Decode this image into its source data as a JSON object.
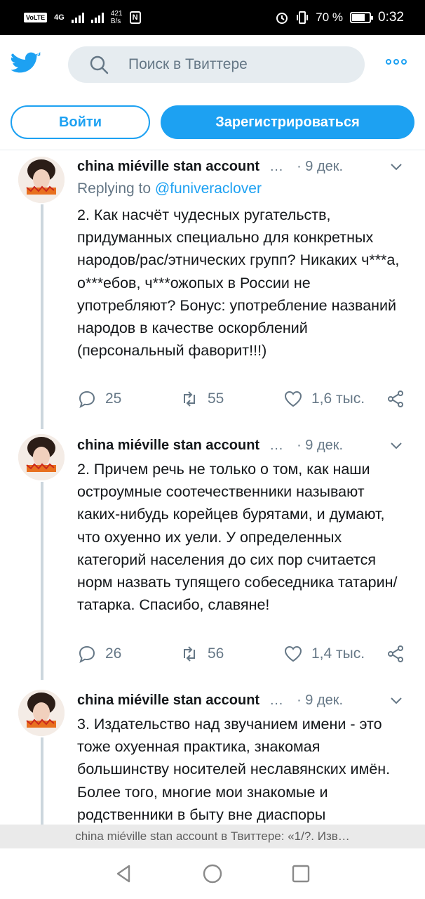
{
  "status_bar": {
    "volte": "VoLTE",
    "network": "4G",
    "speed": "421\nB/s",
    "nfc": "N",
    "battery": "70 %",
    "time": "0:32"
  },
  "header": {
    "logo_icon": "twitter-bird-icon",
    "search_placeholder": "Поиск в Твиттере",
    "more_icon": "more-dots-icon",
    "login_label": "Войти",
    "signup_label": "Зарегистрироваться",
    "accent_color": "#1da1f2"
  },
  "tweets": [
    {
      "name": "china miéville stan account",
      "dots": "…",
      "time": "· 9 дек.",
      "replying_prefix": "Replying to",
      "replying_handle": "@funiveraclover",
      "text": "2. Как насчёт чудесных ругательств, придуманных специально для конкретных народов/рас/этнических групп? Никаких ч***а, о***ебов, ч***ожопых в России не употребляют? Бонус: употребление названий народов в качестве оскорблений (персональный фаворит!!!)",
      "replies": "25",
      "retweets": "55",
      "likes": "1,6 тыс."
    },
    {
      "name": "china miéville stan account",
      "dots": "…",
      "time": "· 9 дек.",
      "text": "2. Причем речь не только о том, как наши остроумные соотечественники называют каких-нибудь корейцев бурятами, и думают, что охуенно их уели. У определенных категорий населения до сих пор считается норм назвать тупящего собеседника татарин/татарка. Спасибо, славяне!",
      "replies": "26",
      "retweets": "56",
      "likes": "1,4 тыс."
    },
    {
      "name": "china miéville stan account",
      "dots": "…",
      "time": "· 9 дек.",
      "text": "3. Издательство над звучанием имени - это тоже охуенная практика, знакомая большинству носителей неславянских имён. Более того, многие мои знакомые и родственники в быту вне диаспоры"
    }
  ],
  "page_caption": "china miéville stan account в Твиттере: «1/?. Изв…",
  "nav": {
    "back_icon": "back-triangle-icon",
    "home_icon": "home-circle-icon",
    "recents_icon": "recents-square-icon"
  }
}
